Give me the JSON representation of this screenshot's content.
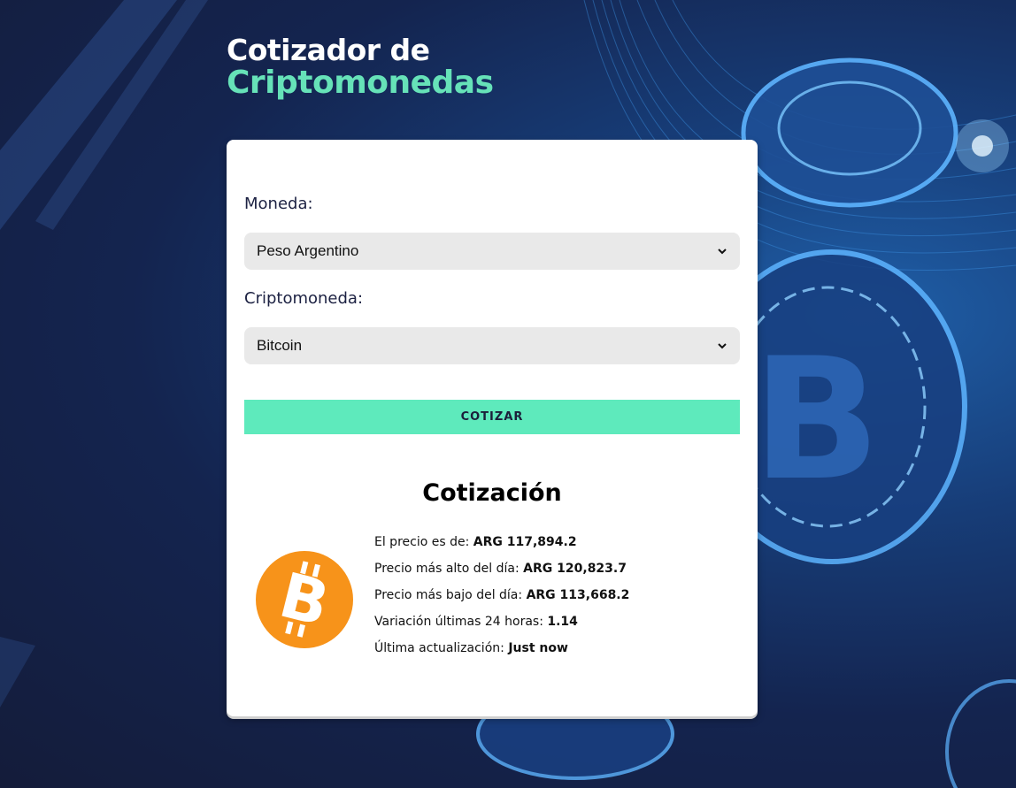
{
  "header": {
    "title_line1": "Cotizador de",
    "title_line2": "Criptomonedas"
  },
  "form": {
    "currency_label": "Moneda:",
    "currency_selected": "Peso Argentino",
    "crypto_label": "Criptomoneda:",
    "crypto_selected": "Bitcoin",
    "submit_label": "COTIZAR"
  },
  "result": {
    "title": "Cotización",
    "coin_icon": "bitcoin-logo",
    "rows": [
      {
        "label": "El precio es de: ",
        "value": "ARG 117,894.2"
      },
      {
        "label": "Precio más alto del día: ",
        "value": "ARG 120,823.7"
      },
      {
        "label": "Precio más bajo del día: ",
        "value": "ARG 113,668.2"
      },
      {
        "label": "Variación últimas 24 horas: ",
        "value": "1.14"
      },
      {
        "label": "Última actualización: ",
        "value": "Just now"
      }
    ]
  },
  "colors": {
    "accent": "#5eeabc",
    "title_accent": "#66e2b8",
    "bitcoin": "#f7931a",
    "background": "#141c3a"
  }
}
